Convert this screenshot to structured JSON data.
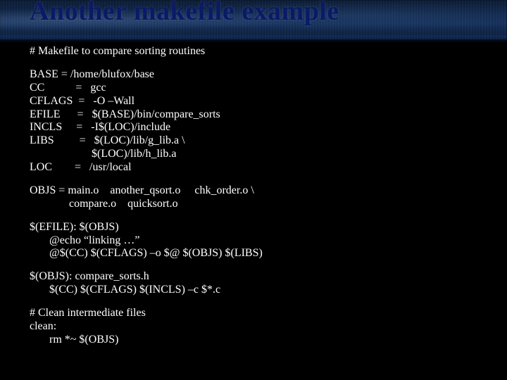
{
  "title": "Another makefile example",
  "lines": {
    "comment1": "# Makefile to compare sorting routines",
    "vars": "BASE = /home/blufox/base\nCC           =   gcc\nCFLAGS  =   -O –Wall\nEFILE      =   $(BASE)/bin/compare_sorts\nINCLS     =   -I$(LOC)/include\nLIBS         =   $(LOC)/lib/g_lib.a \\\n                      $(LOC)/lib/h_lib.a\nLOC        =   /usr/local",
    "objs": "OBJS = main.o    another_qsort.o     chk_order.o \\\n              compare.o    quicksort.o",
    "efile_rule": "$(EFILE): $(OBJS)\n       @echo “linking …”\n       @$(CC) $(CFLAGS) –o $@ $(OBJS) $(LIBS)",
    "objs_rule": "$(OBJS): compare_sorts.h\n       $(CC) $(CFLAGS) $(INCLS) –c $*.c",
    "clean": "# Clean intermediate files\nclean:\n       rm *~ $(OBJS)"
  }
}
